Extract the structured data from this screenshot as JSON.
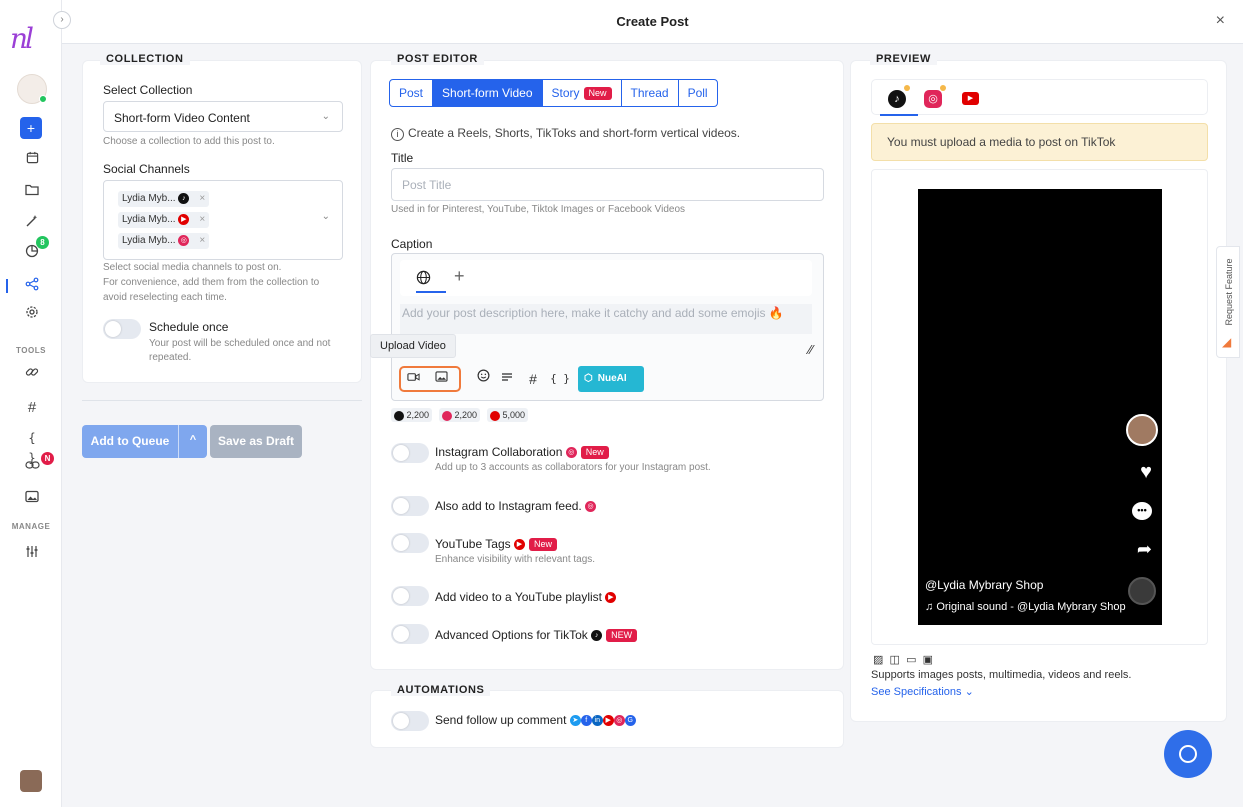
{
  "colors": {
    "brand": "#2563eb",
    "accent_purple": "#9b3fd6",
    "tiktok": "#111111",
    "instagram": "#e0265a",
    "youtube": "#e10000",
    "nueai": "#25b7d3"
  },
  "sidebar": {
    "logo": "nl",
    "plus": "+",
    "tools_label": "TOOLS",
    "manage_label": "MANAGE",
    "badge_analytics": "8",
    "badge_links": "N"
  },
  "modal": {
    "title": "Create Post",
    "close": "×"
  },
  "collection": {
    "section_label": "COLLECTION",
    "select_label": "Select Collection",
    "select_value": "Short-form Video Content",
    "select_help": "Choose a collection to add this post to.",
    "channels_label": "Social Channels",
    "channels": [
      {
        "name": "Lydia Myb...",
        "platform": "tiktok",
        "remove": "×"
      },
      {
        "name": "Lydia Myb...",
        "platform": "youtube",
        "remove": "×"
      },
      {
        "name": "Lydia Myb...",
        "platform": "instagram",
        "remove": "×"
      }
    ],
    "channels_help_1": "Select social media channels to post on.",
    "channels_help_2": "For convenience, add them from the collection to",
    "channels_help_3": "avoid reselecting each time.",
    "schedule_label": "Schedule once",
    "schedule_help_1": "Your post will be scheduled once and not",
    "schedule_help_2": "repeated."
  },
  "actions": {
    "add_to_queue": "Add to Queue",
    "queue_caret": "^",
    "save_draft": "Save as Draft"
  },
  "editor": {
    "section_label": "POST EDITOR",
    "tabs": [
      "Post",
      "Short-form Video",
      "Story",
      "Thread",
      "Poll"
    ],
    "story_badge": "New",
    "info_text": "Create a Reels, Shorts, TikToks and short-form vertical videos.",
    "title_label": "Title",
    "title_placeholder": "Post Title",
    "title_help": "Used in for Pinterest, YouTube, Tiktok Images or Facebook Videos",
    "caption_label": "Caption",
    "caption_placeholder": "Add your post description here, make it catchy and add some emojis",
    "tooltip": "Upload Video",
    "nueai": "NueAI",
    "hash": "#",
    "braces": "{ }",
    "counts": [
      {
        "platform": "tiktok",
        "value": "2,200"
      },
      {
        "platform": "instagram",
        "value": "2,200"
      },
      {
        "platform": "youtube",
        "value": "5,000"
      }
    ],
    "options": [
      {
        "title": "Instagram Collaboration",
        "badge": "New",
        "sub": "Add up to 3 accounts as collaborators for your Instagram post."
      },
      {
        "title": "Also add to Instagram feed.",
        "badge": "",
        "sub": ""
      },
      {
        "title": "YouTube Tags",
        "badge": "New",
        "sub": "Enhance visibility with relevant tags."
      },
      {
        "title": "Add video to a YouTube playlist",
        "badge": "",
        "sub": ""
      },
      {
        "title": "Advanced Options for TikTok",
        "badge": "NEW",
        "sub": ""
      }
    ]
  },
  "automations": {
    "section_label": "AUTOMATIONS",
    "followup": "Send follow up comment"
  },
  "preview": {
    "section_label": "PREVIEW",
    "warning": "You must upload a media to post on TikTok",
    "username": "@Lydia Mybrary Shop",
    "sound": "Original sound - @Lydia Mybrary Shop",
    "supports": "Supports images posts, multimedia, videos and reels.",
    "specs": "See Specifications",
    "specs_caret": "⌄"
  },
  "request_feature": "Request Feature"
}
